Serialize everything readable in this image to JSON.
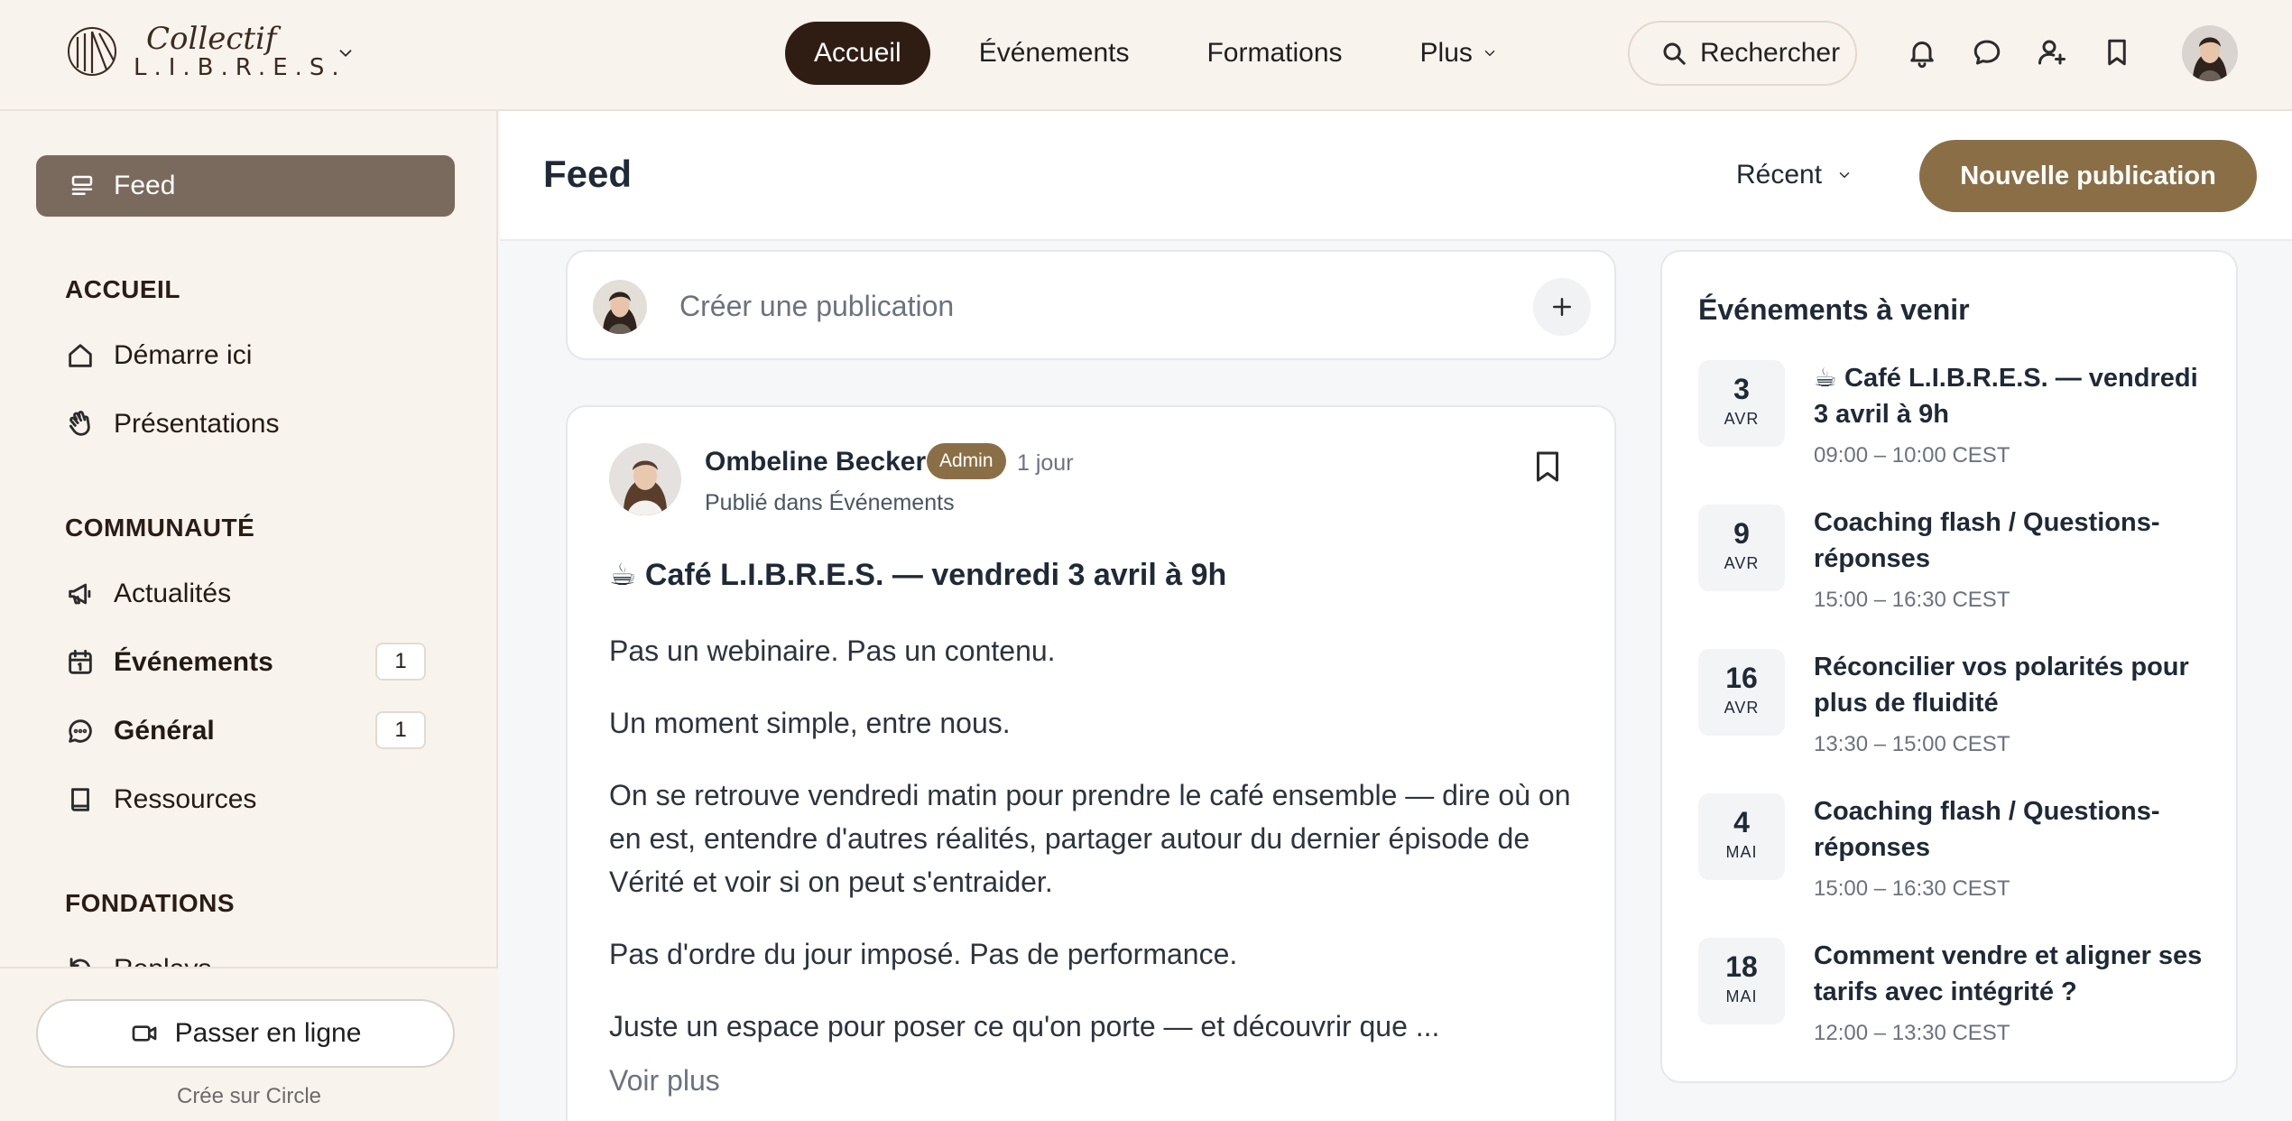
{
  "brand": {
    "script": "Collectif",
    "caps": "L.I.B.R.E.S."
  },
  "nav": [
    {
      "label": "Accueil"
    },
    {
      "label": "Événements"
    },
    {
      "label": "Formations"
    },
    {
      "label": "Plus"
    }
  ],
  "search_label": "Rechercher",
  "sidebar": {
    "feed": "Feed",
    "sections": [
      {
        "title": "ACCUEIL",
        "items": [
          {
            "label": "Démarre ici"
          },
          {
            "label": "Présentations"
          }
        ]
      },
      {
        "title": "COMMUNAUTÉ",
        "items": [
          {
            "label": "Actualités"
          },
          {
            "label": "Événements",
            "count": "1"
          },
          {
            "label": "Général",
            "count": "1"
          },
          {
            "label": "Ressources"
          }
        ]
      },
      {
        "title": "FONDATIONS",
        "items": [
          {
            "label": "Replays"
          }
        ]
      }
    ],
    "live_button": "Passer en ligne",
    "footer": "Crée sur Circle"
  },
  "header": {
    "title": "Feed",
    "sort": "Récent",
    "new_post": "Nouvelle publication"
  },
  "composer": {
    "placeholder": "Créer une publication"
  },
  "post": {
    "author": "Ombeline Becker",
    "badge": "Admin",
    "time": "1 jour",
    "posted_in": "Publié dans Événements",
    "title": "☕ Café L.I.B.R.E.S. — vendredi 3 avril à 9h",
    "paragraphs": [
      "Pas un webinaire. Pas un contenu.",
      "Un moment simple, entre nous.",
      "On se retrouve vendredi matin pour prendre le café ensemble — dire où on en est, entendre d'autres réalités, partager autour du dernier épisode de Vérité et voir si on peut s'entraider.",
      "Pas d'ordre du jour imposé. Pas de performance.",
      "Juste un espace pour poser ce qu'on porte — et découvrir que ..."
    ],
    "more": "Voir plus"
  },
  "events": {
    "title": "Événements à venir",
    "items": [
      {
        "day": "3",
        "month": "AVR",
        "title": "☕ Café L.I.B.R.E.S. — vendredi 3 avril à 9h",
        "hours": "09:00 – 10:00 CEST"
      },
      {
        "day": "9",
        "month": "AVR",
        "title": "Coaching flash / Questions-réponses",
        "hours": "15:00 – 16:30 CEST"
      },
      {
        "day": "16",
        "month": "AVR",
        "title": "Réconcilier vos polarités pour plus de fluidité",
        "hours": "13:30 – 15:00 CEST"
      },
      {
        "day": "4",
        "month": "MAI",
        "title": "Coaching flash / Questions-réponses",
        "hours": "15:00 – 16:30 CEST"
      },
      {
        "day": "18",
        "month": "MAI",
        "title": "Comment vendre et aligner ses tarifs avec intégrité ?",
        "hours": "12:00 – 13:30 CEST"
      }
    ]
  },
  "colors": {
    "accent": "#8a6f46",
    "nav_active": "#2f1d14",
    "sidebar_bg": "#f8f3ec",
    "feed_active": "#7a6a5e"
  }
}
